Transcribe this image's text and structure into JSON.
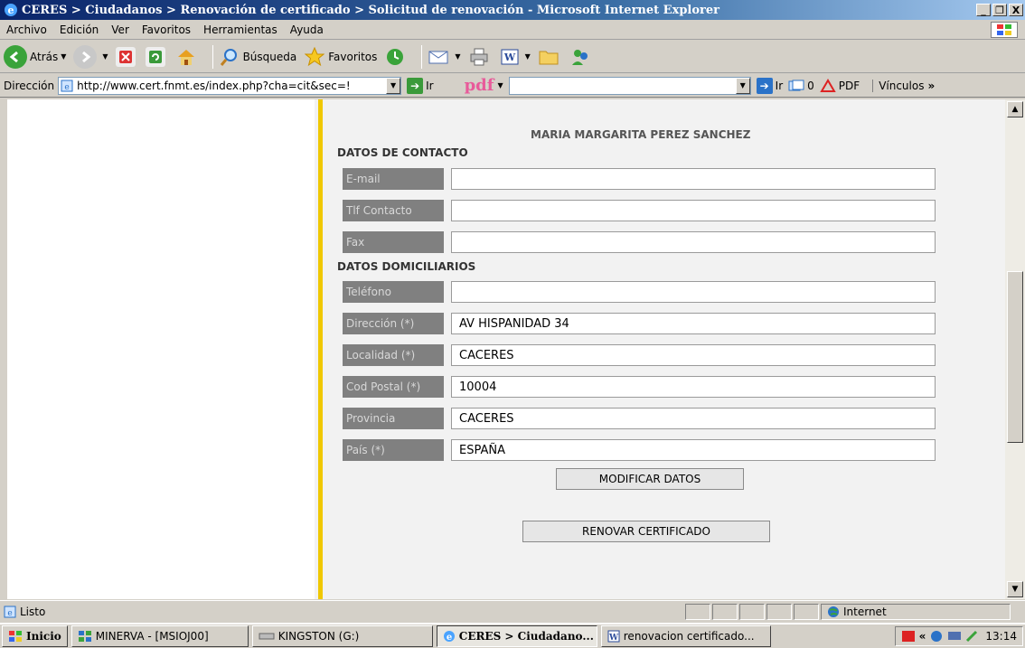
{
  "window": {
    "title": "CERES > Ciudadanos > Renovación de certificado > Solicitud de renovación - Microsoft Internet Explorer",
    "controls": [
      "_",
      "❐",
      "X"
    ]
  },
  "menu": [
    "Archivo",
    "Edición",
    "Ver",
    "Favoritos",
    "Herramientas",
    "Ayuda"
  ],
  "toolbar": {
    "back_label": "Atrás",
    "search_label": "Búsqueda",
    "favorites_label": "Favoritos"
  },
  "address": {
    "label": "Dirección",
    "url": "http://www.cert.fnmt.es/index.php?cha=cit&sec=!",
    "go_label": "Ir",
    "pdf_logo": "pdf",
    "pdf_go_label": "Ir",
    "counter": "0",
    "pdf_button": "PDF",
    "links_label": "Vínculos"
  },
  "page": {
    "person_name": "MARIA MARGARITA PEREZ SANCHEZ",
    "contact_section": "DATOS DE CONTACTO",
    "home_section": "DATOS DOMICILIARIOS",
    "contact_fields": [
      {
        "label": "E-mail",
        "value": ""
      },
      {
        "label": "Tlf Contacto",
        "value": ""
      },
      {
        "label": "Fax",
        "value": ""
      }
    ],
    "home_fields": [
      {
        "label": "Teléfono",
        "value": ""
      },
      {
        "label": "Dirección (*)",
        "value": "AV HISPANIDAD 34"
      },
      {
        "label": "Localidad (*)",
        "value": "CACERES"
      },
      {
        "label": "Cod Postal (*)",
        "value": "10004"
      },
      {
        "label": "Provincia",
        "value": "CACERES"
      },
      {
        "label": "País (*)",
        "value": "ESPAÑA"
      }
    ],
    "modify_button": "MODIFICAR DATOS",
    "renew_button": "RENOVAR CERTIFICADO"
  },
  "status": {
    "text": "Listo",
    "zone": "Internet"
  },
  "taskbar": {
    "start": "Inicio",
    "tasks": [
      "MINERVA - [MSIOJ00]",
      "KINGSTON (G:)",
      "CERES > Ciudadano...",
      "renovacion certificado..."
    ],
    "clock": "13:14"
  },
  "colors": {
    "accent_yellow": "#f0c800",
    "label_bg": "#808080",
    "title_bar": "#0a246a"
  }
}
